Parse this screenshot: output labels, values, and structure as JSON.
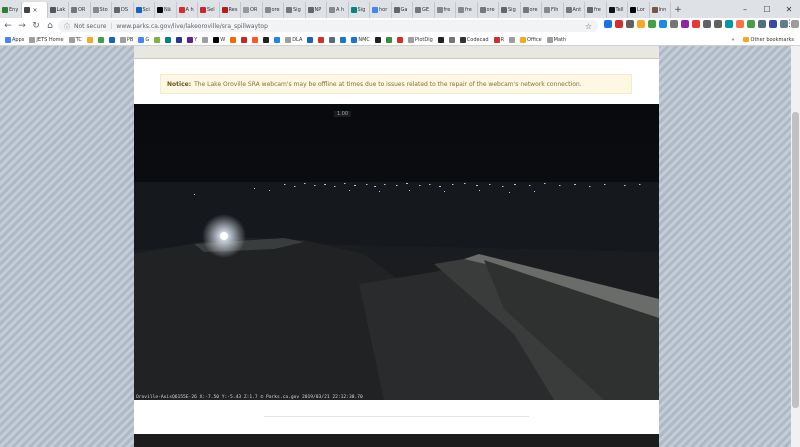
{
  "browser": {
    "tabs": [
      {
        "label": "Eny",
        "color": "#2e7d32",
        "active": false
      },
      {
        "label": "",
        "color": "#444444",
        "active": true
      },
      {
        "label": "Lak",
        "color": "#555555",
        "active": false
      },
      {
        "label": "OR",
        "color": "#777777",
        "active": false
      },
      {
        "label": "Sto",
        "color": "#888888",
        "active": false
      },
      {
        "label": "DS",
        "color": "#666666",
        "active": false
      },
      {
        "label": "Sci",
        "color": "#1565c0",
        "active": false
      },
      {
        "label": "Nā",
        "color": "#000000",
        "active": false
      },
      {
        "label": "A h",
        "color": "#d32f2f",
        "active": false
      },
      {
        "label": "Sel",
        "color": "#c62828",
        "active": false
      },
      {
        "label": "Res",
        "color": "#b71c1c",
        "active": false
      },
      {
        "label": "OR",
        "color": "#999999",
        "active": false
      },
      {
        "label": "ore",
        "color": "#888888",
        "active": false
      },
      {
        "label": "Sig",
        "color": "#777777",
        "active": false
      },
      {
        "label": "NP",
        "color": "#666666",
        "active": false
      },
      {
        "label": "A h",
        "color": "#888888",
        "active": false
      },
      {
        "label": "Sig",
        "color": "#00897b",
        "active": false
      },
      {
        "label": "hor",
        "color": "#4285f4",
        "active": false
      },
      {
        "label": "Ga",
        "color": "#666666",
        "active": false
      },
      {
        "label": "GE",
        "color": "#777777",
        "active": false
      },
      {
        "label": "fre",
        "color": "#888888",
        "active": false
      },
      {
        "label": "fre",
        "color": "#888888",
        "active": false
      },
      {
        "label": "ore",
        "color": "#777777",
        "active": false
      },
      {
        "label": "Sig",
        "color": "#666666",
        "active": false
      },
      {
        "label": "ore",
        "color": "#777777",
        "active": false
      },
      {
        "label": "Flh",
        "color": "#888888",
        "active": false
      },
      {
        "label": "Ant",
        "color": "#777777",
        "active": false
      },
      {
        "label": "fre",
        "color": "#666666",
        "active": false
      },
      {
        "label": "Tell",
        "color": "#111111",
        "active": false
      },
      {
        "label": "Lor",
        "color": "#000000",
        "active": false
      },
      {
        "label": "Inn",
        "color": "#795548",
        "active": false
      }
    ],
    "active_tab_close": "×",
    "new_tab": "+",
    "window_controls": {
      "minimize": "–",
      "maximize": "☐",
      "close": "✕"
    },
    "toolbar": {
      "back": "←",
      "forward": "→",
      "reload": "↻",
      "home": "⌂",
      "security_icon": "ⓘ",
      "security_text": "Not secure",
      "url": "www.parks.ca.gov/live/lakeoroville/sra_spillwaytop",
      "bookmark_star": "☆",
      "menu": "⋮"
    },
    "extension_colors": [
      "#1a73e8",
      "#d32f2f",
      "#616161",
      "#f9a825",
      "#43a047",
      "#1e88e5",
      "#757575",
      "#8e24aa",
      "#e53935",
      "#5f6368",
      "#616161",
      "#0097a7",
      "#ff7043",
      "#43a047",
      "#546e7a",
      "#3949ab",
      "#607d8b",
      "#9e9e9e"
    ],
    "bookmarks": [
      {
        "label": "Apps",
        "color": "#4285f4"
      },
      {
        "label": "JETS Home",
        "color": "#9e9e9e"
      },
      {
        "label": "TC",
        "color": "#9e9e9e"
      },
      {
        "label": "",
        "color": "#f9a825"
      },
      {
        "label": "",
        "color": "#43a047"
      },
      {
        "label": "",
        "color": "#1565c0"
      },
      {
        "label": "PB",
        "color": "#9e9e9e"
      },
      {
        "label": "G",
        "color": "#4285f4"
      },
      {
        "label": "",
        "color": "#7cb342"
      },
      {
        "label": "",
        "color": "#00838f"
      },
      {
        "label": "",
        "color": "#283593"
      },
      {
        "label": "Y",
        "color": "#6a1b9a"
      },
      {
        "label": "",
        "color": "#9e9e9e"
      },
      {
        "label": "W",
        "color": "#000000"
      },
      {
        "label": "",
        "color": "#ef6c00"
      },
      {
        "label": "",
        "color": "#c62828"
      },
      {
        "label": "",
        "color": "#ff5722"
      },
      {
        "label": "",
        "color": "#212121"
      },
      {
        "label": "",
        "color": "#1e88e5"
      },
      {
        "label": "DLA",
        "color": "#9e9e9e"
      },
      {
        "label": "",
        "color": "#1565c0"
      },
      {
        "label": "",
        "color": "#d32f2f"
      },
      {
        "label": "",
        "color": "#546e7a"
      },
      {
        "label": "",
        "color": "#1976d2"
      },
      {
        "label": "NMC",
        "color": "#1976d2"
      },
      {
        "label": "",
        "color": "#212121"
      },
      {
        "label": "",
        "color": "#388e3c"
      },
      {
        "label": "",
        "color": "#d32f2f"
      },
      {
        "label": "PlotDig",
        "color": "#9e9e9e"
      },
      {
        "label": "",
        "color": "#212121"
      },
      {
        "label": "",
        "color": "#757575"
      },
      {
        "label": "Codecad",
        "color": "#333333"
      },
      {
        "label": "R",
        "color": "#d32f2f"
      },
      {
        "label": "",
        "color": "#9e9e9e"
      },
      {
        "label": "Office",
        "color": "#f9a825"
      },
      {
        "label": "Math",
        "color": "#9e9e9e"
      }
    ],
    "bookmarks_overflow": "»",
    "other_bookmarks": "Other bookmarks"
  },
  "page": {
    "notice_bold": "Notice:",
    "notice_text": "The Lake Oroville SRA webcam's may be offline at times due to issues related to the repair of the webcam's network connection.",
    "webcam": {
      "zoom_label": "1.00",
      "caption": "Oroville-AxisQ6155E-26 X:-7.50 Y:-5.43 Z:1.7  © Parks.ca.gov 2019/03/21 22:12:38.70"
    }
  }
}
